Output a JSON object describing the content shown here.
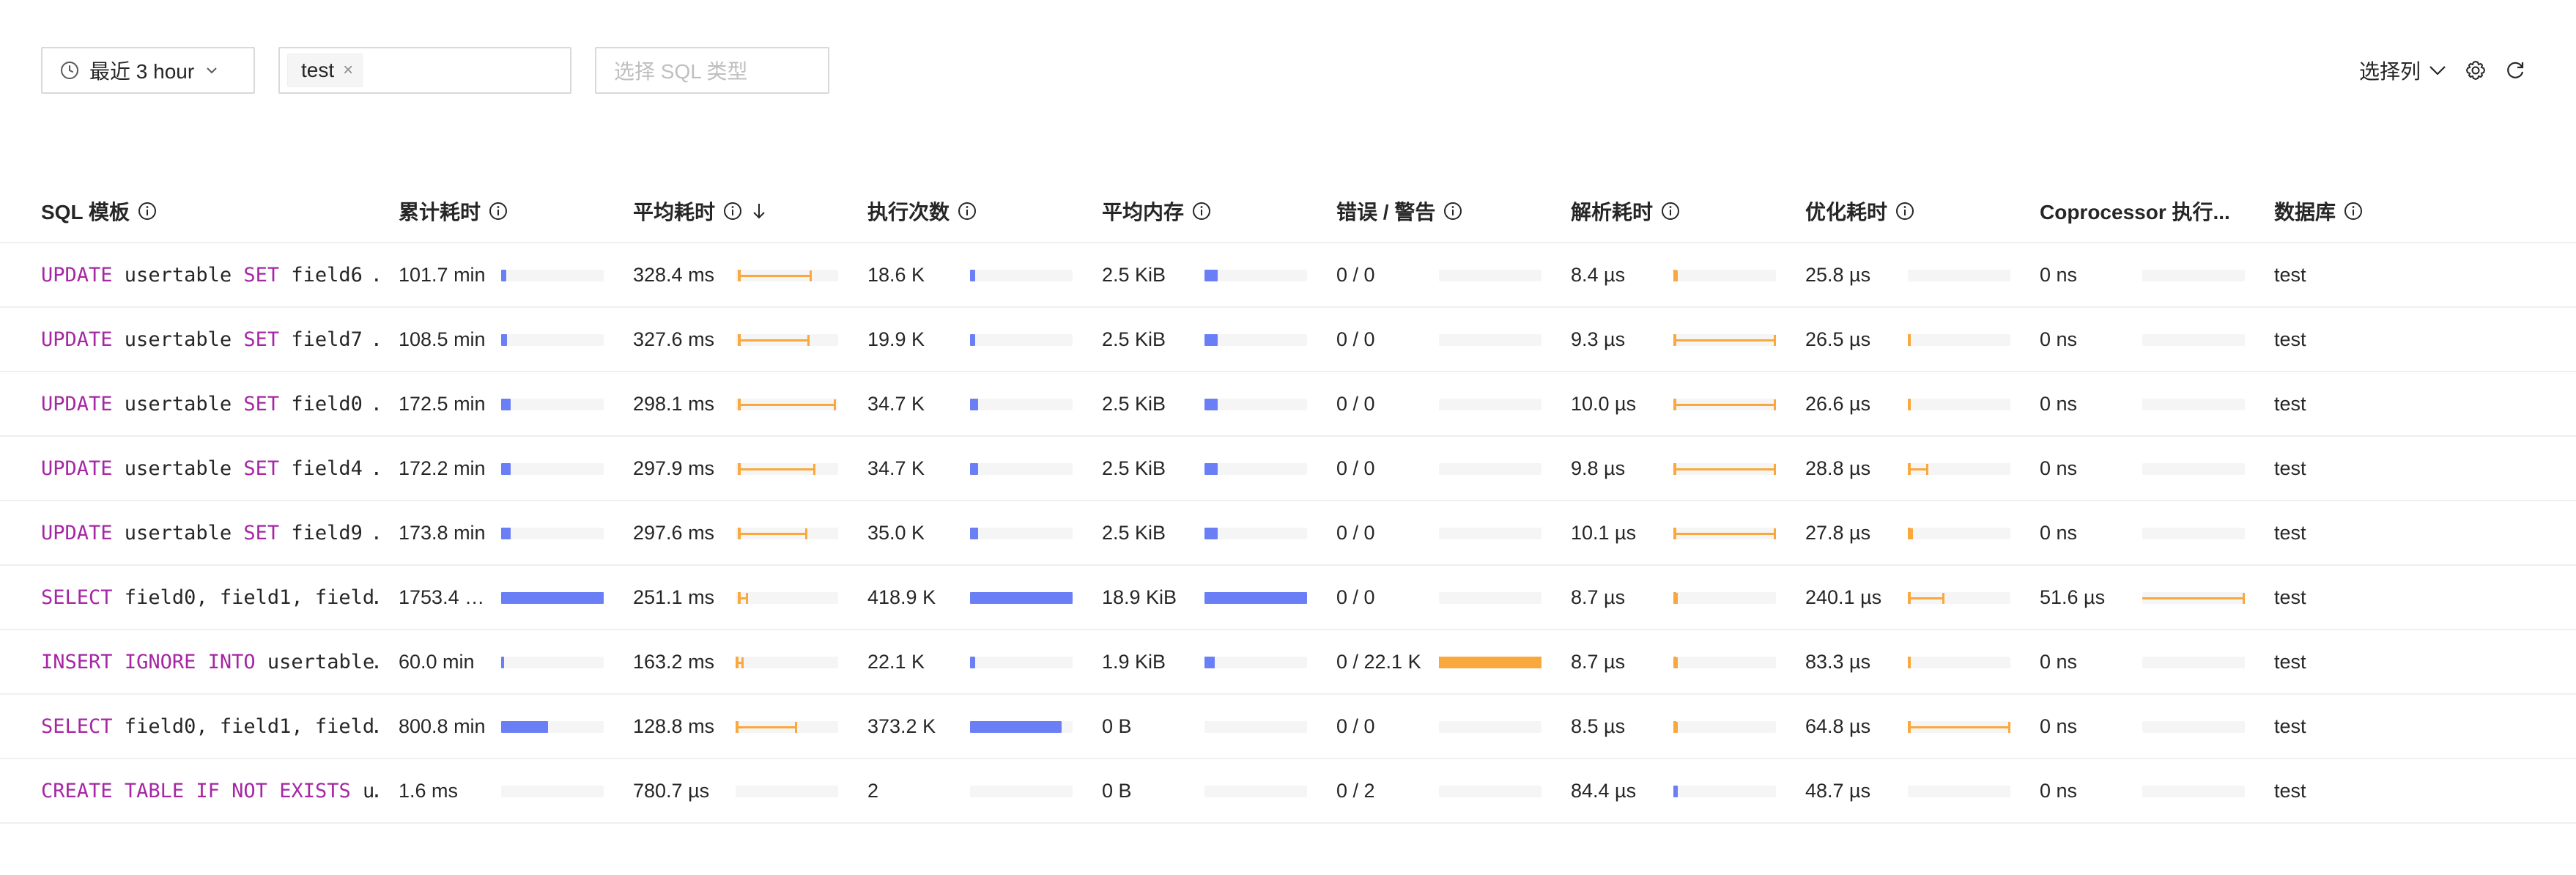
{
  "toolbar": {
    "time_range": "最近 3 hour",
    "database_tags": [
      "test"
    ],
    "sql_type_placeholder": "选择 SQL 类型",
    "column_selector": "选择列"
  },
  "colors": {
    "accent": "#6a7ff6",
    "warning": "#f9a83d",
    "keyword": "#a626a4"
  },
  "columns": [
    "SQL 模板",
    "累计耗时",
    "平均耗时",
    "执行次数",
    "平均内存",
    "错误 / 警告",
    "解析耗时",
    "优化耗时",
    "Coprocessor 执行...",
    "数据库"
  ],
  "rows": [
    {
      "sql": [
        [
          "UPDATE",
          "kw"
        ],
        [
          " usertable ",
          ""
        ],
        [
          "SET",
          "kw"
        ],
        [
          " field6 …",
          ""
        ]
      ],
      "sum_latency": "101.7 min",
      "sum_latency_pct": 0.05,
      "avg_latency": "328.4 ms",
      "avg_latency_range": [
        0.02,
        0.74
      ],
      "avg_latency_mean": 0.02,
      "exec_count": "18.6 K",
      "exec_count_pct": 0.05,
      "avg_mem": "2.5 KiB",
      "avg_mem_pct": 0.13,
      "errors": "0 / 0",
      "errors_pct": 0,
      "parse": "8.4 µs",
      "parse_range": [
        0.0,
        0.04
      ],
      "parse_mean": 0.0,
      "compile": "25.8 µs",
      "compile_range": null,
      "compile_mean": null,
      "cop": "0 ns",
      "cop_range": null,
      "db": "test"
    },
    {
      "sql": [
        [
          "UPDATE",
          "kw"
        ],
        [
          " usertable ",
          ""
        ],
        [
          "SET",
          "kw"
        ],
        [
          " field7 …",
          ""
        ]
      ],
      "sum_latency": "108.5 min",
      "sum_latency_pct": 0.06,
      "avg_latency": "327.6 ms",
      "avg_latency_range": [
        0.02,
        0.72
      ],
      "avg_latency_mean": 0.02,
      "exec_count": "19.9 K",
      "exec_count_pct": 0.05,
      "avg_mem": "2.5 KiB",
      "avg_mem_pct": 0.13,
      "errors": "0 / 0",
      "errors_pct": 0,
      "parse": "9.3 µs",
      "parse_range": [
        0.0,
        1.0
      ],
      "parse_mean": 0.0,
      "compile": "26.5 µs",
      "compile_range": [
        0.0,
        0.02
      ],
      "compile_mean": 0.0,
      "cop": "0 ns",
      "cop_range": null,
      "db": "test"
    },
    {
      "sql": [
        [
          "UPDATE",
          "kw"
        ],
        [
          " usertable ",
          ""
        ],
        [
          "SET",
          "kw"
        ],
        [
          " field0 …",
          ""
        ]
      ],
      "sum_latency": "172.5 min",
      "sum_latency_pct": 0.09,
      "avg_latency": "298.1 ms",
      "avg_latency_range": [
        0.02,
        0.98
      ],
      "avg_latency_mean": 0.02,
      "exec_count": "34.7 K",
      "exec_count_pct": 0.08,
      "avg_mem": "2.5 KiB",
      "avg_mem_pct": 0.13,
      "errors": "0 / 0",
      "errors_pct": 0,
      "parse": "10.0 µs",
      "parse_range": [
        0.0,
        1.0
      ],
      "parse_mean": 0.0,
      "compile": "26.6 µs",
      "compile_range": [
        0.0,
        0.02
      ],
      "compile_mean": 0.0,
      "cop": "0 ns",
      "cop_range": null,
      "db": "test"
    },
    {
      "sql": [
        [
          "UPDATE",
          "kw"
        ],
        [
          " usertable ",
          ""
        ],
        [
          "SET",
          "kw"
        ],
        [
          " field4 …",
          ""
        ]
      ],
      "sum_latency": "172.2 min",
      "sum_latency_pct": 0.09,
      "avg_latency": "297.9 ms",
      "avg_latency_range": [
        0.02,
        0.78
      ],
      "avg_latency_mean": 0.02,
      "exec_count": "34.7 K",
      "exec_count_pct": 0.08,
      "avg_mem": "2.5 KiB",
      "avg_mem_pct": 0.13,
      "errors": "0 / 0",
      "errors_pct": 0,
      "parse": "9.8 µs",
      "parse_range": [
        0.0,
        1.0
      ],
      "parse_mean": 0.0,
      "compile": "28.8 µs",
      "compile_range": [
        0.0,
        0.2
      ],
      "compile_mean": 0.0,
      "cop": "0 ns",
      "cop_range": null,
      "db": "test"
    },
    {
      "sql": [
        [
          "UPDATE",
          "kw"
        ],
        [
          " usertable ",
          ""
        ],
        [
          "SET",
          "kw"
        ],
        [
          " field9 …",
          ""
        ]
      ],
      "sum_latency": "173.8 min",
      "sum_latency_pct": 0.09,
      "avg_latency": "297.6 ms",
      "avg_latency_range": [
        0.02,
        0.7
      ],
      "avg_latency_mean": 0.02,
      "exec_count": "35.0 K",
      "exec_count_pct": 0.08,
      "avg_mem": "2.5 KiB",
      "avg_mem_pct": 0.13,
      "errors": "0 / 0",
      "errors_pct": 0,
      "parse": "10.1 µs",
      "parse_range": [
        0.0,
        1.0
      ],
      "parse_mean": 0.0,
      "compile": "27.8 µs",
      "compile_range": [
        0.0,
        0.05
      ],
      "compile_mean": 0.0,
      "cop": "0 ns",
      "cop_range": null,
      "db": "test"
    },
    {
      "sql": [
        [
          "SELECT",
          "kw"
        ],
        [
          " field0, field1, field…",
          ""
        ]
      ],
      "sum_latency": "1753.4 …",
      "sum_latency_pct": 1.0,
      "avg_latency": "251.1 ms",
      "avg_latency_range": [
        0.02,
        0.12
      ],
      "avg_latency_mean": 0.02,
      "exec_count": "418.9 K",
      "exec_count_pct": 1.0,
      "avg_mem": "18.9 KiB",
      "avg_mem_pct": 1.0,
      "errors": "0 / 0",
      "errors_pct": 0,
      "parse": "8.7 µs",
      "parse_range": [
        0.0,
        0.04
      ],
      "parse_mean": 0.0,
      "compile": "240.1 µs",
      "compile_range": [
        0.0,
        0.36
      ],
      "compile_mean": 0.0,
      "cop": "51.6 µs",
      "cop_range": [
        0.0,
        1.0
      ],
      "db": "test"
    },
    {
      "sql": [
        [
          "INSERT",
          "kw"
        ],
        [
          " ",
          ""
        ],
        [
          "IGNORE",
          "kw"
        ],
        [
          " ",
          ""
        ],
        [
          "INTO",
          "kw"
        ],
        [
          " usertable…",
          ""
        ]
      ],
      "sum_latency": "60.0 min",
      "sum_latency_pct": 0.03,
      "avg_latency": "163.2 ms",
      "avg_latency_range": [
        0.0,
        0.08
      ],
      "avg_latency_mean": 0.0,
      "exec_count": "22.1 K",
      "exec_count_pct": 0.05,
      "avg_mem": "1.9 KiB",
      "avg_mem_pct": 0.1,
      "errors": "0 / 22.1 K",
      "errors_pct": 1.0,
      "parse": "8.7 µs",
      "parse_range": [
        0.0,
        0.04
      ],
      "parse_mean": 0.0,
      "compile": "83.3 µs",
      "compile_range": [
        0.0,
        0.02
      ],
      "compile_mean": 0.0,
      "cop": "0 ns",
      "cop_range": null,
      "db": "test"
    },
    {
      "sql": [
        [
          "SELECT",
          "kw"
        ],
        [
          " field0, field1, field…",
          ""
        ]
      ],
      "sum_latency": "800.8 min",
      "sum_latency_pct": 0.46,
      "avg_latency": "128.8 ms",
      "avg_latency_range": [
        0.0,
        0.6
      ],
      "avg_latency_mean": 0.0,
      "exec_count": "373.2 K",
      "exec_count_pct": 0.89,
      "avg_mem": "0 B",
      "avg_mem_pct": 0,
      "errors": "0 / 0",
      "errors_pct": 0,
      "parse": "8.5 µs",
      "parse_range": [
        0.0,
        0.04
      ],
      "parse_mean": 0.0,
      "compile": "64.8 µs",
      "compile_range": [
        0.0,
        1.0
      ],
      "compile_mean": 0.0,
      "cop": "0 ns",
      "cop_range": null,
      "db": "test"
    },
    {
      "sql": [
        [
          "CREATE",
          "kw"
        ],
        [
          " ",
          ""
        ],
        [
          "TABLE",
          "kw"
        ],
        [
          " ",
          ""
        ],
        [
          "IF",
          "kw"
        ],
        [
          " ",
          ""
        ],
        [
          "NOT",
          "kw"
        ],
        [
          " ",
          ""
        ],
        [
          "EXISTS",
          "kw"
        ],
        [
          " u…",
          ""
        ]
      ],
      "sum_latency": "1.6 ms",
      "sum_latency_pct": 0,
      "avg_latency": "780.7 µs",
      "avg_latency_range": null,
      "avg_latency_mean": null,
      "exec_count": "2",
      "exec_count_pct": 0,
      "avg_mem": "0 B",
      "avg_mem_pct": 0,
      "errors": "0 / 2",
      "errors_pct": 0,
      "parse": "84.4 µs",
      "parse_range": null,
      "parse_mean": null,
      "parse_fill": 0.04,
      "compile": "48.7 µs",
      "compile_range": null,
      "compile_mean": null,
      "cop": "0 ns",
      "cop_range": null,
      "db": "test"
    }
  ]
}
